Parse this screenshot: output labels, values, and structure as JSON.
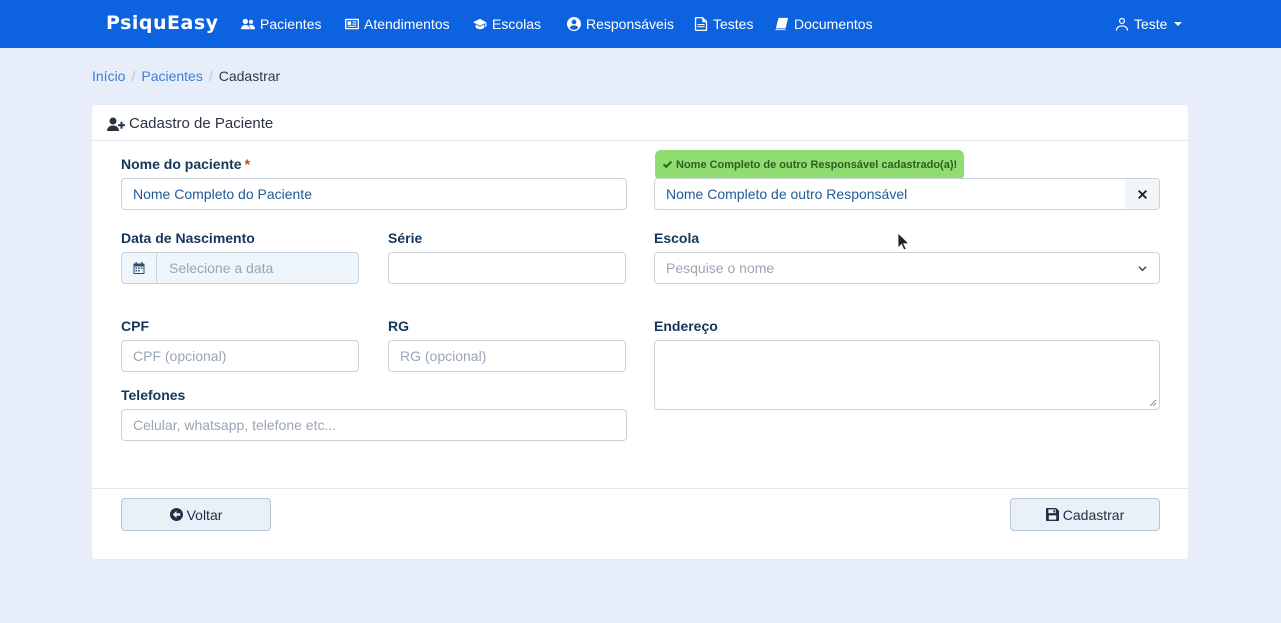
{
  "nav": {
    "brand": "PsiquEasy",
    "items": [
      {
        "label": "Pacientes",
        "icon": "users-icon"
      },
      {
        "label": "Atendimentos",
        "icon": "id-card-icon"
      },
      {
        "label": "Escolas",
        "icon": "graduation-cap-icon"
      },
      {
        "label": "Responsáveis",
        "icon": "user-circle-icon"
      },
      {
        "label": "Testes",
        "icon": "file-text-icon"
      },
      {
        "label": "Documentos",
        "icon": "book-icon"
      }
    ],
    "user": {
      "label": "Teste",
      "icon": "user-icon"
    }
  },
  "breadcrumb": [
    "Início",
    "Pacientes",
    "Cadastrar"
  ],
  "card": {
    "title": "Cadastro de Paciente",
    "title_icon": "user-plus-icon"
  },
  "form": {
    "nome_label": "Nome do paciente",
    "nome_required": "*",
    "nome_value": "Nome Completo do Paciente",
    "responsavel_badge": "Nome Completo de outro Responsável cadastrado(a)!",
    "responsavel_value": "Nome Completo de outro Responsável",
    "data_label": "Data de Nascimento",
    "data_placeholder": "Selecione a data",
    "serie_label": "Série",
    "serie_value": "",
    "escola_label": "Escola",
    "escola_placeholder": "Pesquise o nome",
    "cpf_label": "CPF",
    "cpf_placeholder": "CPF (opcional)",
    "rg_label": "RG",
    "rg_placeholder": "RG (opcional)",
    "endereco_label": "Endereço",
    "telefones_label": "Telefones",
    "telefones_placeholder": "Celular, whatsapp, telefone etc..."
  },
  "buttons": {
    "voltar": "Voltar",
    "cadastrar": "Cadastrar"
  },
  "colors": {
    "navbar": "#0d62e0",
    "background": "#e7eef9",
    "badge": "#8fdc70",
    "required": "#d9341b"
  }
}
